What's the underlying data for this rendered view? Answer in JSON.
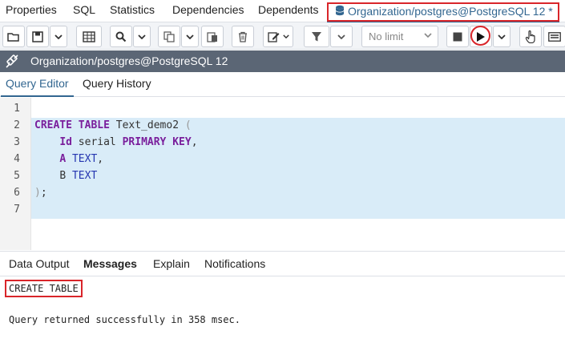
{
  "tabs": {
    "properties": "Properties",
    "sql": "SQL",
    "statistics": "Statistics",
    "dependencies": "Dependencies",
    "dependents": "Dependents",
    "query_tab": "Organization/postgres@PostgreSQL 12 *"
  },
  "toolbar": {
    "limit_label": "No limit"
  },
  "connection": {
    "label": "Organization/postgres@PostgreSQL 12"
  },
  "editor_tabs": {
    "query_editor": "Query Editor",
    "query_history": "Query History"
  },
  "editor": {
    "line_numbers": [
      "1",
      "2",
      "3",
      "4",
      "5",
      "6",
      "7"
    ],
    "line2": {
      "kw": "CREATE TABLE",
      "name": " Text_demo2 ",
      "paren": "("
    },
    "line3": {
      "col": "Id",
      "type": " serial ",
      "kw": "PRIMARY KEY",
      "comma": ","
    },
    "line4": {
      "col": "A",
      "type": " TEXT",
      "comma": ","
    },
    "line5": {
      "col": "B",
      "type": " TEXT"
    },
    "line6": {
      "paren": ")",
      "semi": ";"
    }
  },
  "results": {
    "tabs": {
      "data_output": "Data Output",
      "messages": "Messages",
      "explain": "Explain",
      "notifications": "Notifications"
    },
    "message_title": "CREATE TABLE",
    "message_text": "Query returned successfully in 358 msec."
  },
  "colors": {
    "accent": "#326690",
    "highlight": "#d9252a",
    "selection": "#d9ecf8",
    "keyword": "#7a1f9c",
    "type": "#2536b0",
    "connection_bar": "#5b6675"
  }
}
